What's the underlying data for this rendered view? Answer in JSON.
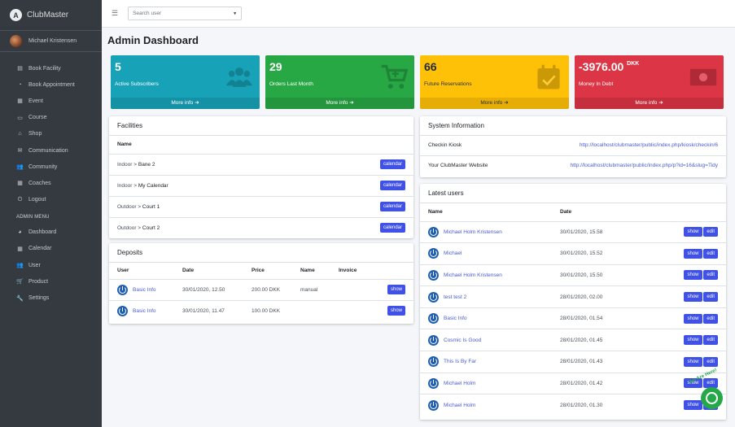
{
  "app": {
    "brand": "ClubMaster",
    "user_name": "Michael Kristensen"
  },
  "sidebar": {
    "items": [
      {
        "icon": "table-icon",
        "label": "Book Facility"
      },
      {
        "icon": "clock-icon",
        "label": "Book Appointment"
      },
      {
        "icon": "calendar-icon",
        "label": "Event"
      },
      {
        "icon": "chalkboard-icon",
        "label": "Course"
      },
      {
        "icon": "store-icon",
        "label": "Shop"
      },
      {
        "icon": "envelope-icon",
        "label": "Communication"
      },
      {
        "icon": "users-icon",
        "label": "Community"
      },
      {
        "icon": "calendar-icon",
        "label": "Coaches"
      },
      {
        "icon": "power-icon",
        "label": "Logout"
      }
    ],
    "admin_header": "ADMIN MENU",
    "admin_items": [
      {
        "icon": "dashboard-icon",
        "label": "Dashboard"
      },
      {
        "icon": "calendar-icon",
        "label": "Calendar"
      },
      {
        "icon": "users-icon",
        "label": "User"
      },
      {
        "icon": "cart-icon",
        "label": "Product"
      },
      {
        "icon": "wrench-icon",
        "label": "Settings"
      }
    ]
  },
  "topbar": {
    "search_placeholder": "Search user"
  },
  "page": {
    "title": "Admin Dashboard"
  },
  "info_boxes": [
    {
      "value": "5",
      "unit": "",
      "label": "Active Subscribers",
      "more": "More info",
      "color": "#17a2b8",
      "icon": "users-icon"
    },
    {
      "value": "29",
      "unit": "",
      "label": "Orders Last Month",
      "more": "More info",
      "color": "#28a745",
      "icon": "cart-icon"
    },
    {
      "value": "66",
      "unit": "",
      "label": "Future Reservations",
      "more": "More info",
      "color": "#ffc107",
      "icon": "calendar-check-icon"
    },
    {
      "value": "-3976.00",
      "unit": "DKK",
      "label": "Money In Debt",
      "more": "More info",
      "color": "#dc3545",
      "icon": "money-icon"
    }
  ],
  "facilities": {
    "title": "Facilities",
    "column": "Name",
    "rows": [
      {
        "group": "Indoor",
        "name": "Bane 2",
        "action": "calendar"
      },
      {
        "group": "Indoor",
        "name": "My Calendar",
        "action": "calendar"
      },
      {
        "group": "Outdoor",
        "name": "Court 1",
        "action": "calendar"
      },
      {
        "group": "Outdoor",
        "name": "Court 2",
        "action": "calendar"
      }
    ]
  },
  "deposits": {
    "title": "Deposits",
    "columns": [
      "User",
      "Date",
      "Price",
      "Name",
      "Invoice"
    ],
    "rows": [
      {
        "user": "Basic Info",
        "date": "30/01/2020, 12.50",
        "price": "200.00 DKK",
        "name": "manual",
        "action": "show"
      },
      {
        "user": "Basic Info",
        "date": "30/01/2020, 11.47",
        "price": "100.00 DKK",
        "name": "",
        "action": "show"
      }
    ]
  },
  "system_info": {
    "title": "System Information",
    "rows": [
      {
        "label": "Checkin Kiosk",
        "value": "http://localhost/clubmaster/public/index.php/kiosk/checkin/6"
      },
      {
        "label": "Your ClubMaster Website",
        "value": "http://localhost/clubmaster/public/index.php/p?id=16&slug=Tidy"
      }
    ]
  },
  "latest_users": {
    "title": "Latest users",
    "columns": [
      "Name",
      "Date"
    ],
    "show_label": "show",
    "edit_label": "edit",
    "rows": [
      {
        "name": "Michael Holm Kristensen",
        "date": "30/01/2020, 15.58"
      },
      {
        "name": "Michael",
        "date": "30/01/2020, 15.52"
      },
      {
        "name": "Michael Holm Kristensen",
        "date": "30/01/2020, 15.50"
      },
      {
        "name": "test test 2",
        "date": "28/01/2020, 02.00"
      },
      {
        "name": "Basic Info",
        "date": "28/01/2020, 01.54"
      },
      {
        "name": "Cosmic Is Good",
        "date": "28/01/2020, 01.45"
      },
      {
        "name": "This Is By Far",
        "date": "28/01/2020, 01.43"
      },
      {
        "name": "Michael Holm",
        "date": "28/01/2020, 01.42"
      },
      {
        "name": "Michael Holm",
        "date": "28/01/2020, 01.30"
      }
    ]
  },
  "chat": {
    "label": "We Are Here!"
  }
}
